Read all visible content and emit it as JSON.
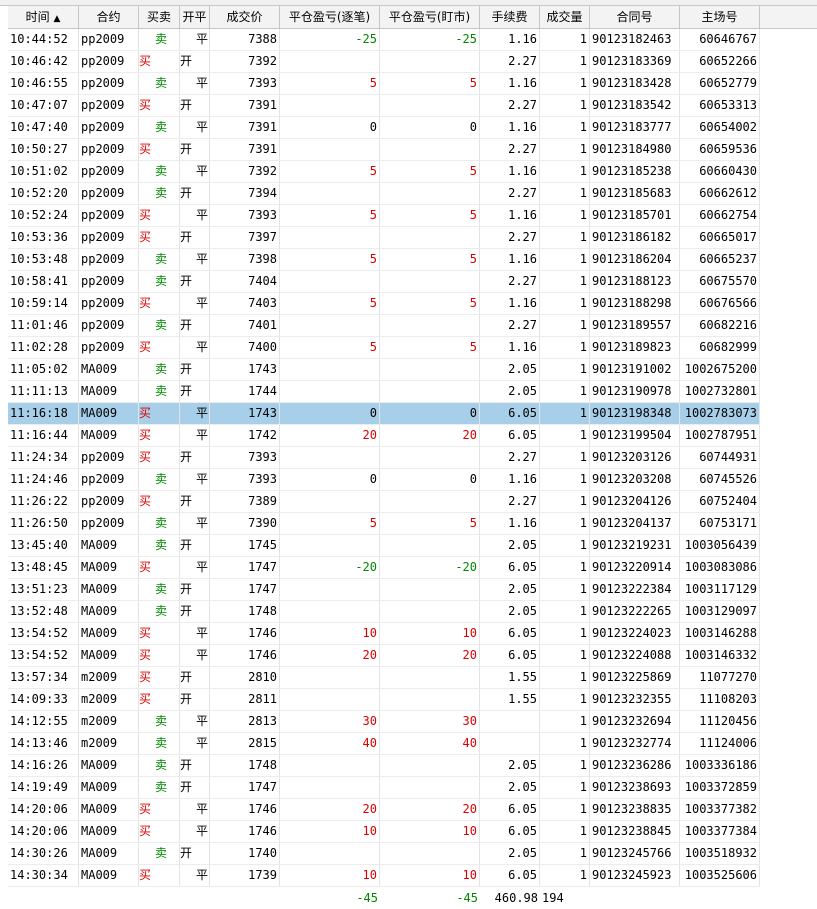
{
  "columns": {
    "time": "时间",
    "sort_indicator": "▲",
    "contract": "合约",
    "buy_sell": "买卖",
    "open_close": "开平",
    "price": "成交价",
    "pl_trade": "平仓盈亏(逐笔)",
    "pl_mark": "平仓盈亏(盯市)",
    "fee": "手续费",
    "volume": "成交量",
    "contract_no": "合同号",
    "match_no": "主场号"
  },
  "labels": {
    "buy": "买",
    "sell": "卖",
    "open": "开",
    "close": "平"
  },
  "colors": {
    "buy": "#dd0000",
    "sell": "#008800",
    "profit": "#dd0000",
    "loss": "#008800",
    "selected_row": "#a7cfe9"
  },
  "selected_index": 17,
  "rows": [
    {
      "time": "10:44:52",
      "contract": "pp2009",
      "side": "sell",
      "oc": "close",
      "price": "7388",
      "pl1": "-25",
      "pl2": "-25",
      "fee": "1.16",
      "vol": "1",
      "cid": "90123182463",
      "mid": "60646767"
    },
    {
      "time": "10:46:42",
      "contract": "pp2009",
      "side": "buy",
      "oc": "open",
      "price": "7392",
      "pl1": "",
      "pl2": "",
      "fee": "2.27",
      "vol": "1",
      "cid": "90123183369",
      "mid": "60652266"
    },
    {
      "time": "10:46:55",
      "contract": "pp2009",
      "side": "sell",
      "oc": "close",
      "price": "7393",
      "pl1": "5",
      "pl2": "5",
      "fee": "1.16",
      "vol": "1",
      "cid": "90123183428",
      "mid": "60652779"
    },
    {
      "time": "10:47:07",
      "contract": "pp2009",
      "side": "buy",
      "oc": "open",
      "price": "7391",
      "pl1": "",
      "pl2": "",
      "fee": "2.27",
      "vol": "1",
      "cid": "90123183542",
      "mid": "60653313"
    },
    {
      "time": "10:47:40",
      "contract": "pp2009",
      "side": "sell",
      "oc": "close",
      "price": "7391",
      "pl1": "0",
      "pl2": "0",
      "fee": "1.16",
      "vol": "1",
      "cid": "90123183777",
      "mid": "60654002"
    },
    {
      "time": "10:50:27",
      "contract": "pp2009",
      "side": "buy",
      "oc": "open",
      "price": "7391",
      "pl1": "",
      "pl2": "",
      "fee": "2.27",
      "vol": "1",
      "cid": "90123184980",
      "mid": "60659536"
    },
    {
      "time": "10:51:02",
      "contract": "pp2009",
      "side": "sell",
      "oc": "close",
      "price": "7392",
      "pl1": "5",
      "pl2": "5",
      "fee": "1.16",
      "vol": "1",
      "cid": "90123185238",
      "mid": "60660430"
    },
    {
      "time": "10:52:20",
      "contract": "pp2009",
      "side": "sell",
      "oc": "open",
      "price": "7394",
      "pl1": "",
      "pl2": "",
      "fee": "2.27",
      "vol": "1",
      "cid": "90123185683",
      "mid": "60662612"
    },
    {
      "time": "10:52:24",
      "contract": "pp2009",
      "side": "buy",
      "oc": "close",
      "price": "7393",
      "pl1": "5",
      "pl2": "5",
      "fee": "1.16",
      "vol": "1",
      "cid": "90123185701",
      "mid": "60662754"
    },
    {
      "time": "10:53:36",
      "contract": "pp2009",
      "side": "buy",
      "oc": "open",
      "price": "7397",
      "pl1": "",
      "pl2": "",
      "fee": "2.27",
      "vol": "1",
      "cid": "90123186182",
      "mid": "60665017"
    },
    {
      "time": "10:53:48",
      "contract": "pp2009",
      "side": "sell",
      "oc": "close",
      "price": "7398",
      "pl1": "5",
      "pl2": "5",
      "fee": "1.16",
      "vol": "1",
      "cid": "90123186204",
      "mid": "60665237"
    },
    {
      "time": "10:58:41",
      "contract": "pp2009",
      "side": "sell",
      "oc": "open",
      "price": "7404",
      "pl1": "",
      "pl2": "",
      "fee": "2.27",
      "vol": "1",
      "cid": "90123188123",
      "mid": "60675570"
    },
    {
      "time": "10:59:14",
      "contract": "pp2009",
      "side": "buy",
      "oc": "close",
      "price": "7403",
      "pl1": "5",
      "pl2": "5",
      "fee": "1.16",
      "vol": "1",
      "cid": "90123188298",
      "mid": "60676566"
    },
    {
      "time": "11:01:46",
      "contract": "pp2009",
      "side": "sell",
      "oc": "open",
      "price": "7401",
      "pl1": "",
      "pl2": "",
      "fee": "2.27",
      "vol": "1",
      "cid": "90123189557",
      "mid": "60682216"
    },
    {
      "time": "11:02:28",
      "contract": "pp2009",
      "side": "buy",
      "oc": "close",
      "price": "7400",
      "pl1": "5",
      "pl2": "5",
      "fee": "1.16",
      "vol": "1",
      "cid": "90123189823",
      "mid": "60682999"
    },
    {
      "time": "11:05:02",
      "contract": "MA009",
      "side": "sell",
      "oc": "open",
      "price": "1743",
      "pl1": "",
      "pl2": "",
      "fee": "2.05",
      "vol": "1",
      "cid": "90123191002",
      "mid": "1002675200"
    },
    {
      "time": "11:11:13",
      "contract": "MA009",
      "side": "sell",
      "oc": "open",
      "price": "1744",
      "pl1": "",
      "pl2": "",
      "fee": "2.05",
      "vol": "1",
      "cid": "90123190978",
      "mid": "1002732801"
    },
    {
      "time": "11:16:18",
      "contract": "MA009",
      "side": "buy",
      "oc": "close",
      "price": "1743",
      "pl1": "0",
      "pl2": "0",
      "fee": "6.05",
      "vol": "1",
      "cid": "90123198348",
      "mid": "1002783073"
    },
    {
      "time": "11:16:44",
      "contract": "MA009",
      "side": "buy",
      "oc": "close",
      "price": "1742",
      "pl1": "20",
      "pl2": "20",
      "fee": "6.05",
      "vol": "1",
      "cid": "90123199504",
      "mid": "1002787951"
    },
    {
      "time": "11:24:34",
      "contract": "pp2009",
      "side": "buy",
      "oc": "open",
      "price": "7393",
      "pl1": "",
      "pl2": "",
      "fee": "2.27",
      "vol": "1",
      "cid": "90123203126",
      "mid": "60744931"
    },
    {
      "time": "11:24:46",
      "contract": "pp2009",
      "side": "sell",
      "oc": "close",
      "price": "7393",
      "pl1": "0",
      "pl2": "0",
      "fee": "1.16",
      "vol": "1",
      "cid": "90123203208",
      "mid": "60745526"
    },
    {
      "time": "11:26:22",
      "contract": "pp2009",
      "side": "buy",
      "oc": "open",
      "price": "7389",
      "pl1": "",
      "pl2": "",
      "fee": "2.27",
      "vol": "1",
      "cid": "90123204126",
      "mid": "60752404"
    },
    {
      "time": "11:26:50",
      "contract": "pp2009",
      "side": "sell",
      "oc": "close",
      "price": "7390",
      "pl1": "5",
      "pl2": "5",
      "fee": "1.16",
      "vol": "1",
      "cid": "90123204137",
      "mid": "60753171"
    },
    {
      "time": "13:45:40",
      "contract": "MA009",
      "side": "sell",
      "oc": "open",
      "price": "1745",
      "pl1": "",
      "pl2": "",
      "fee": "2.05",
      "vol": "1",
      "cid": "90123219231",
      "mid": "1003056439"
    },
    {
      "time": "13:48:45",
      "contract": "MA009",
      "side": "buy",
      "oc": "close",
      "price": "1747",
      "pl1": "-20",
      "pl2": "-20",
      "fee": "6.05",
      "vol": "1",
      "cid": "90123220914",
      "mid": "1003083086"
    },
    {
      "time": "13:51:23",
      "contract": "MA009",
      "side": "sell",
      "oc": "open",
      "price": "1747",
      "pl1": "",
      "pl2": "",
      "fee": "2.05",
      "vol": "1",
      "cid": "90123222384",
      "mid": "1003117129"
    },
    {
      "time": "13:52:48",
      "contract": "MA009",
      "side": "sell",
      "oc": "open",
      "price": "1748",
      "pl1": "",
      "pl2": "",
      "fee": "2.05",
      "vol": "1",
      "cid": "90123222265",
      "mid": "1003129097"
    },
    {
      "time": "13:54:52",
      "contract": "MA009",
      "side": "buy",
      "oc": "close",
      "price": "1746",
      "pl1": "10",
      "pl2": "10",
      "fee": "6.05",
      "vol": "1",
      "cid": "90123224023",
      "mid": "1003146288"
    },
    {
      "time": "13:54:52",
      "contract": "MA009",
      "side": "buy",
      "oc": "close",
      "price": "1746",
      "pl1": "20",
      "pl2": "20",
      "fee": "6.05",
      "vol": "1",
      "cid": "90123224088",
      "mid": "1003146332"
    },
    {
      "time": "13:57:34",
      "contract": "m2009",
      "side": "buy",
      "oc": "open",
      "price": "2810",
      "pl1": "",
      "pl2": "",
      "fee": "1.55",
      "vol": "1",
      "cid": "90123225869",
      "mid": "11077270"
    },
    {
      "time": "14:09:33",
      "contract": "m2009",
      "side": "buy",
      "oc": "open",
      "price": "2811",
      "pl1": "",
      "pl2": "",
      "fee": "1.55",
      "vol": "1",
      "cid": "90123232355",
      "mid": "11108203"
    },
    {
      "time": "14:12:55",
      "contract": "m2009",
      "side": "sell",
      "oc": "close",
      "price": "2813",
      "pl1": "30",
      "pl2": "30",
      "fee": "",
      "vol": "1",
      "cid": "90123232694",
      "mid": "11120456"
    },
    {
      "time": "14:13:46",
      "contract": "m2009",
      "side": "sell",
      "oc": "close",
      "price": "2815",
      "pl1": "40",
      "pl2": "40",
      "fee": "",
      "vol": "1",
      "cid": "90123232774",
      "mid": "11124006"
    },
    {
      "time": "14:16:26",
      "contract": "MA009",
      "side": "sell",
      "oc": "open",
      "price": "1748",
      "pl1": "",
      "pl2": "",
      "fee": "2.05",
      "vol": "1",
      "cid": "90123236286",
      "mid": "1003336186"
    },
    {
      "time": "14:19:49",
      "contract": "MA009",
      "side": "sell",
      "oc": "open",
      "price": "1747",
      "pl1": "",
      "pl2": "",
      "fee": "2.05",
      "vol": "1",
      "cid": "90123238693",
      "mid": "1003372859"
    },
    {
      "time": "14:20:06",
      "contract": "MA009",
      "side": "buy",
      "oc": "close",
      "price": "1746",
      "pl1": "20",
      "pl2": "20",
      "fee": "6.05",
      "vol": "1",
      "cid": "90123238835",
      "mid": "1003377382"
    },
    {
      "time": "14:20:06",
      "contract": "MA009",
      "side": "buy",
      "oc": "close",
      "price": "1746",
      "pl1": "10",
      "pl2": "10",
      "fee": "6.05",
      "vol": "1",
      "cid": "90123238845",
      "mid": "1003377384"
    },
    {
      "time": "14:30:26",
      "contract": "MA009",
      "side": "sell",
      "oc": "open",
      "price": "1740",
      "pl1": "",
      "pl2": "",
      "fee": "2.05",
      "vol": "1",
      "cid": "90123245766",
      "mid": "1003518932"
    },
    {
      "time": "14:30:34",
      "contract": "MA009",
      "side": "buy",
      "oc": "close",
      "price": "1739",
      "pl1": "10",
      "pl2": "10",
      "fee": "6.05",
      "vol": "1",
      "cid": "90123245923",
      "mid": "1003525606"
    }
  ],
  "totals": {
    "pl_trade": "-45",
    "pl_mark": "-45",
    "fee": "460.98",
    "volume": "194"
  }
}
